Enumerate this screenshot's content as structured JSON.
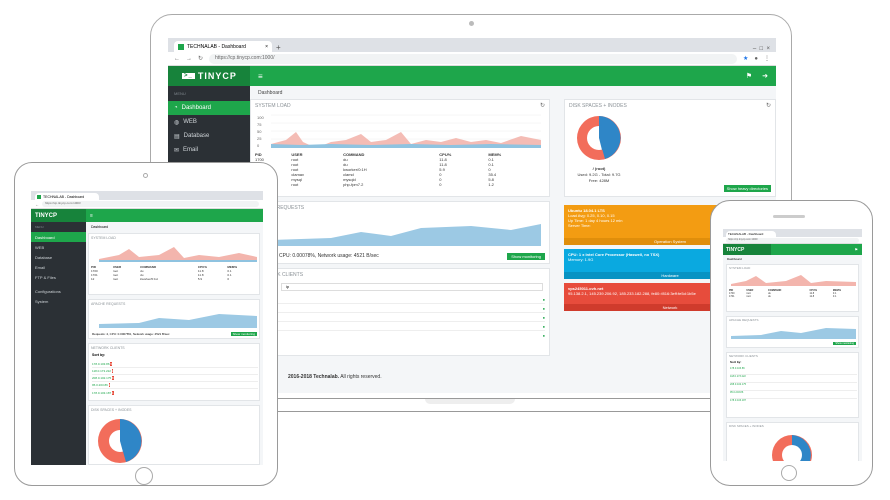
{
  "browser": {
    "tab_title": "TECHNALAB - Dashboard",
    "url": "https://cp.tinycp.com:1000/"
  },
  "app": {
    "logo": "TINYCP",
    "breadcrumb": "Dashboard",
    "menu_header": "MENU"
  },
  "sidebar": {
    "items": [
      {
        "label": "Dashboard",
        "icon": "dashboard-icon"
      },
      {
        "label": "WEB",
        "icon": "globe-icon"
      },
      {
        "label": "Database",
        "icon": "database-icon"
      },
      {
        "label": "Email",
        "icon": "envelope-icon"
      },
      {
        "label": "FTP & Files",
        "icon": "folder-icon"
      },
      {
        "label": "Configurations",
        "icon": "gear-icon"
      },
      {
        "label": "System",
        "icon": "list-icon"
      }
    ]
  },
  "system_load": {
    "title": "SYSTEM LOAD",
    "y_ticks": [
      "100",
      "75",
      "50",
      "25",
      "0"
    ],
    "columns": [
      "PID",
      "USER",
      "COMMAND",
      "CPU%",
      "MEM%"
    ],
    "rows": [
      [
        "1700",
        "root",
        "du",
        "11.8",
        "0.1"
      ],
      [
        "1701",
        "root",
        "du",
        "11.8",
        "0.1"
      ],
      [
        "12",
        "root",
        "kworker/0:1H",
        "5.9",
        "0"
      ],
      [
        "1047",
        "clamav",
        "clamd",
        "0",
        "35.4"
      ],
      [
        "1401",
        "mysql",
        "mysqld",
        "0",
        "5.8"
      ],
      [
        "1151",
        "root",
        "php-fpm7.2",
        "0",
        "1.2"
      ]
    ]
  },
  "disk": {
    "title": "DISK SPACES + INODES",
    "mount": "/ (root)",
    "used": "Used: 9.2G",
    "total": "Total: 9.7G",
    "free": "Free: 428M",
    "button": "Show heavy directories"
  },
  "apache": {
    "title": "APACHE REQUESTS",
    "stats": "Requests: 4, CPU: 0.00078%, Network usage: 4521 B/sec",
    "stats_short": "CPU: 0.00078%, Network usage: 4521 B/sec",
    "button": "Show monitoring"
  },
  "network_clients": {
    "title": "NETWORK CLIENTS",
    "sort_label": "Sort by:",
    "sort_value": "ip",
    "clients": [
      {
        "ip": "178.0.103.86",
        "count": "5"
      },
      {
        "ip": "118.0.173.222",
        "count": "3"
      },
      {
        "ip": "208.0.102.175",
        "count": "8"
      },
      {
        "ip": "95.0.203.86",
        "count": "1"
      },
      {
        "ip": "178.0.103.187",
        "count": "1"
      }
    ]
  },
  "info_cards": {
    "system": {
      "lines": [
        "Ubuntu 18.04.1 LTS",
        "Load Avg: 0.25, 0.10, 0.15",
        "Up Time: 1 day 4 hours 12 min",
        "Server Time:"
      ],
      "footer": "Operation System"
    },
    "hardware": {
      "lines": [
        "CPU: 1 x Intel Core Processor (Haswell, no TSX)",
        "Memory: 1.9G"
      ],
      "footer": "Hardware"
    },
    "network": {
      "lines": [
        "vps245011.ovh.net",
        "95.138.2.1, 145.239.206.92, 185.233.182.288, fe80::f816:3eff:fe5d:1b5e"
      ],
      "footer": "Network"
    }
  },
  "footer": {
    "copyright": "2016-2018 Technalab.",
    "rights": "All rights reserved."
  },
  "colors": {
    "brand": "#1ea64b",
    "sidebar": "#2b3035",
    "orange": "#f39c12",
    "blue": "#0aa9e0",
    "red": "#e74c3c"
  }
}
